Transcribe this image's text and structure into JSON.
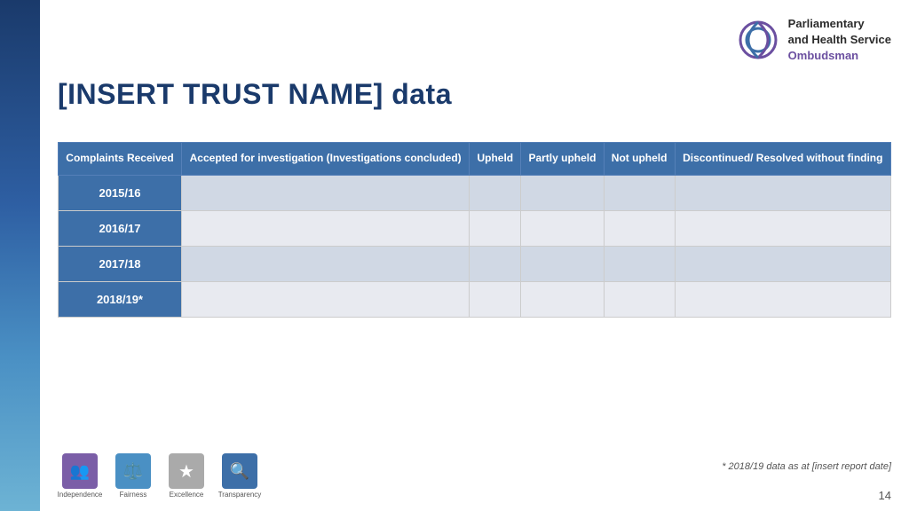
{
  "page": {
    "title": "[INSERT TRUST NAME] data",
    "page_number": "14",
    "footer_note": "* 2018/19 data as at [insert report date]"
  },
  "logo": {
    "line1": "Parliamentary",
    "line2": "and Health Service",
    "line3": "Ombudsman"
  },
  "table": {
    "headers": [
      "Complaints Received",
      "Accepted for investigation (Investigations concluded)",
      "Upheld",
      "Partly upheld",
      "Not upheld",
      "Discontinued/ Resolved without finding"
    ],
    "rows": [
      {
        "year": "2015/16",
        "c1": "",
        "c2": "",
        "c3": "",
        "c4": "",
        "c5": ""
      },
      {
        "year": "2016/17",
        "c1": "",
        "c2": "",
        "c3": "",
        "c4": "",
        "c5": ""
      },
      {
        "year": "2017/18",
        "c1": "",
        "c2": "",
        "c3": "",
        "c4": "",
        "c5": ""
      },
      {
        "year": "2018/19*",
        "c1": "",
        "c2": "",
        "c3": "",
        "c4": "",
        "c5": ""
      }
    ]
  },
  "icons": [
    {
      "name": "Independence",
      "color": "#7b5ea7",
      "symbol": "👥"
    },
    {
      "name": "Fairness",
      "color": "#4a90c4",
      "symbol": "⚖️"
    },
    {
      "name": "Excellence",
      "color": "#aaaaaa",
      "symbol": "★"
    },
    {
      "name": "Transparency",
      "color": "#4a6fa8",
      "symbol": "🔍"
    }
  ]
}
